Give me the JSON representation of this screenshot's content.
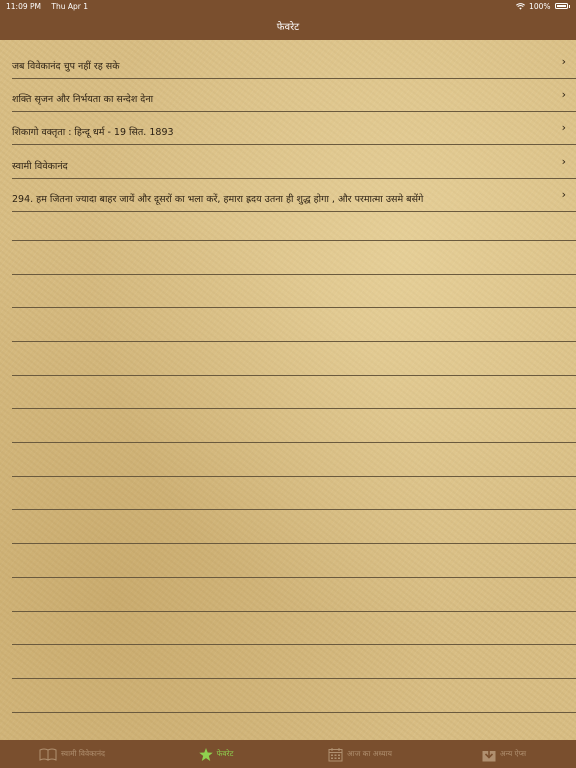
{
  "status": {
    "time": "11:09 PM",
    "date": "Thu Apr 1",
    "battery": "100%"
  },
  "nav": {
    "title": "फेवरेट"
  },
  "favorites": [
    "जब विवेकानंद चुप नहीं रह सके",
    "शक्ति सृजन और निर्भयता का सन्देश देना",
    "शिकागो वक्तृता : हिन्दू धर्म - 19 सित. 1893",
    "स्वामी विवेकानंद",
    "294. हम जितना ज्यादा बाहर जायें और दूसरों का भला करें, हमारा ह्रदय उतना ही शुद्ध होगा , और परमात्मा उसमे बसेंगे"
  ],
  "tabs": [
    {
      "label": "स्वामी विवेकानंद",
      "icon": "book-icon"
    },
    {
      "label": "फेवरेट",
      "icon": "star-icon"
    },
    {
      "label": "आज का अध्याय",
      "icon": "calendar-icon"
    },
    {
      "label": "अन्य ऐप्स",
      "icon": "download-icon"
    }
  ],
  "colors": {
    "bar": "#7a4f2e",
    "active_tab": "#8fd14f",
    "inactive_tab": "#b09070"
  }
}
